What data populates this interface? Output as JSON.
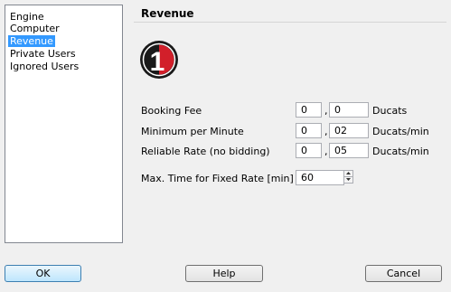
{
  "sidebar": {
    "items": [
      {
        "label": "Engine"
      },
      {
        "label": "Computer"
      },
      {
        "label": "Revenue"
      },
      {
        "label": "Private Users"
      },
      {
        "label": "Ignored Users"
      }
    ],
    "selected": "Revenue"
  },
  "section": {
    "title": "Revenue",
    "logo_icon": "server-number-one-badge-icon",
    "logo_text": "1"
  },
  "fields": {
    "booking_fee": {
      "label": "Booking Fee",
      "whole": "0",
      "separator": ",",
      "fraction": "0",
      "unit": "Ducats"
    },
    "minimum_per_minute": {
      "label": "Minimum per Minute",
      "whole": "0",
      "separator": ",",
      "fraction": "02",
      "unit": "Ducats/min"
    },
    "reliable_rate": {
      "label": "Reliable Rate (no bidding)",
      "whole": "0",
      "separator": ",",
      "fraction": "05",
      "unit": "Ducats/min"
    },
    "max_time_fixed_rate": {
      "label": "Max. Time for Fixed Rate [min]",
      "value": "60"
    }
  },
  "buttons": {
    "ok": "OK",
    "help": "Help",
    "cancel": "Cancel"
  },
  "colors": {
    "selection": "#3399ff",
    "logo_red": "#d21f2a"
  }
}
